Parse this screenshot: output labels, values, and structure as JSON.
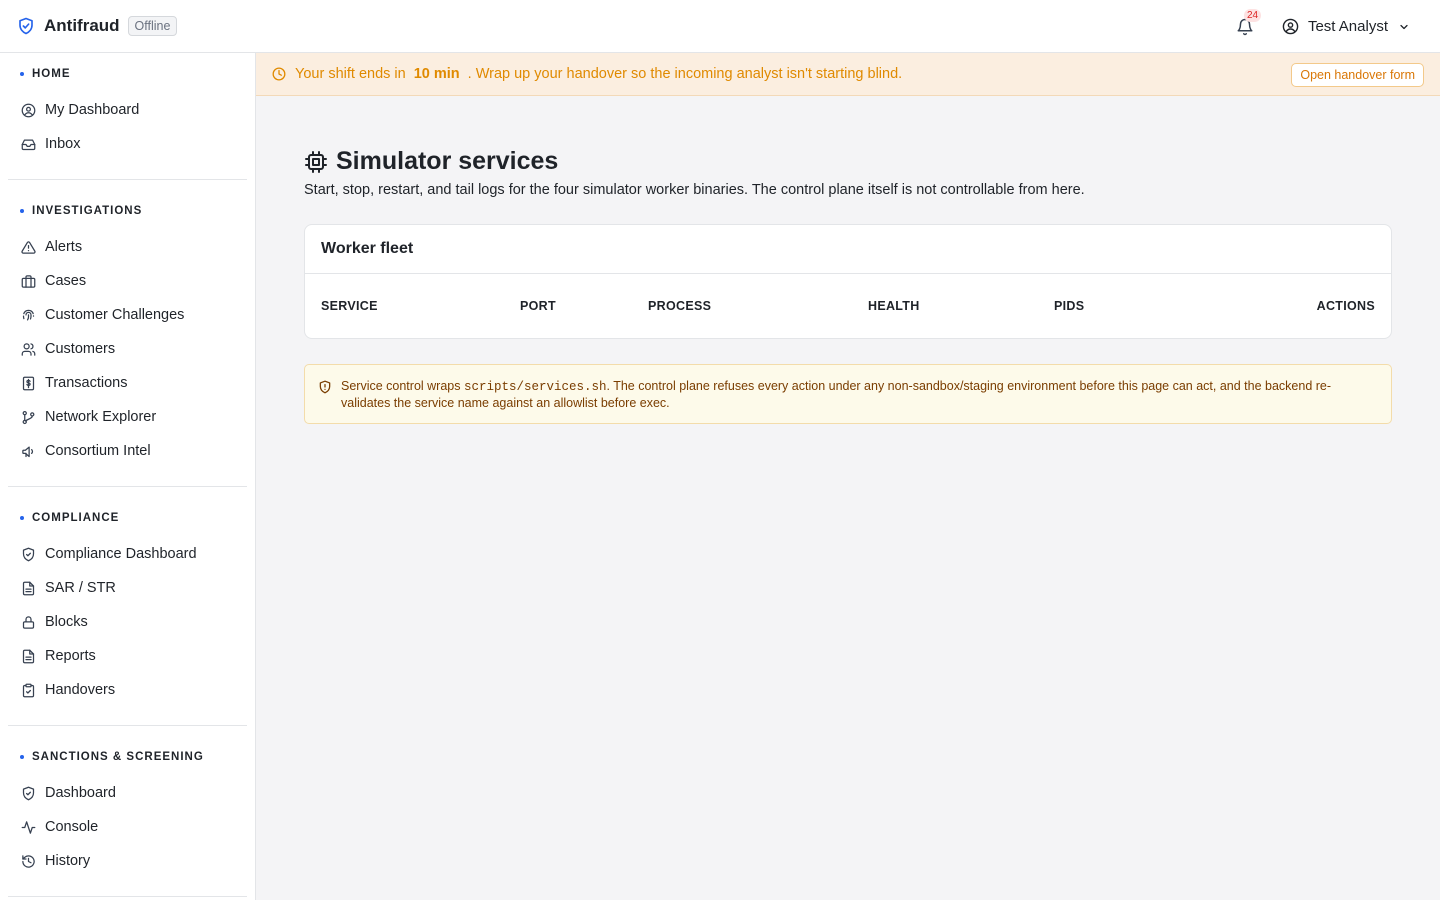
{
  "app": {
    "name": "Antifraud",
    "status_badge": "Offline"
  },
  "topbar": {
    "notification_count": "24",
    "user_name": "Test Analyst"
  },
  "sidebar": {
    "sections": [
      {
        "title": "HOME",
        "items": [
          {
            "label": "My Dashboard",
            "icon": "user-circle-icon"
          },
          {
            "label": "Inbox",
            "icon": "inbox-icon"
          }
        ]
      },
      {
        "title": "INVESTIGATIONS",
        "items": [
          {
            "label": "Alerts",
            "icon": "alert-triangle-icon"
          },
          {
            "label": "Cases",
            "icon": "briefcase-icon"
          },
          {
            "label": "Customer Challenges",
            "icon": "fingerprint-icon"
          },
          {
            "label": "Customers",
            "icon": "users-icon"
          },
          {
            "label": "Transactions",
            "icon": "dollar-receipt-icon"
          },
          {
            "label": "Network Explorer",
            "icon": "git-branch-icon"
          },
          {
            "label": "Consortium Intel",
            "icon": "megaphone-icon"
          }
        ]
      },
      {
        "title": "COMPLIANCE",
        "items": [
          {
            "label": "Compliance Dashboard",
            "icon": "shield-check-icon"
          },
          {
            "label": "SAR / STR",
            "icon": "document-icon"
          },
          {
            "label": "Blocks",
            "icon": "lock-icon"
          },
          {
            "label": "Reports",
            "icon": "document-icon"
          },
          {
            "label": "Handovers",
            "icon": "clipboard-check-icon"
          }
        ]
      },
      {
        "title": "SANCTIONS & SCREENING",
        "items": [
          {
            "label": "Dashboard",
            "icon": "shield-check-icon"
          },
          {
            "label": "Console",
            "icon": "activity-icon"
          },
          {
            "label": "History",
            "icon": "history-icon"
          }
        ]
      }
    ]
  },
  "banner": {
    "prefix": "Your shift ends in",
    "time": "10 min",
    "suffix": ". Wrap up your handover so the incoming analyst isn't starting blind.",
    "button": "Open handover form"
  },
  "page": {
    "title": "Simulator services",
    "subtitle": "Start, stop, restart, and tail logs for the four simulator worker binaries. The control plane itself is not controllable from here."
  },
  "card": {
    "title": "Worker fleet",
    "columns": [
      "SERVICE",
      "PORT",
      "PROCESS",
      "HEALTH",
      "PIDS",
      "ACTIONS"
    ]
  },
  "notice": {
    "text_before": "Service control wraps ",
    "code": "scripts/services.sh",
    "text_after": ". The control plane refuses every action under any non-sandbox/staging environment before this page can act, and the backend re-validates the service name against an allowlist before exec."
  },
  "colors": {
    "accent": "#2563eb",
    "warning": "#e08a00",
    "notice_text": "#7a3d00"
  }
}
